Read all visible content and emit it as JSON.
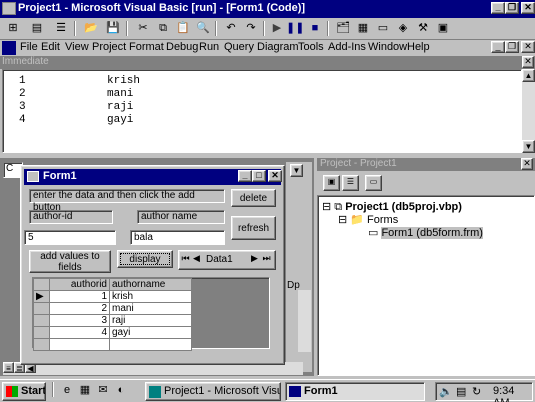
{
  "window": {
    "title": "Project1 - Microsoft Visual Basic [run] - [Form1 (Code)]"
  },
  "menu": [
    "File",
    "Edit",
    "View",
    "Project",
    "Format",
    "Debug",
    "Run",
    "Query",
    "Diagram",
    "Tools",
    "Add-Ins",
    "Window",
    "Help"
  ],
  "immediate": {
    "title": "Immediate",
    "rows": [
      {
        "num": "1",
        "name": "krish"
      },
      {
        "num": "2",
        "name": "mani"
      },
      {
        "num": "3",
        "name": "raji"
      },
      {
        "num": "4",
        "name": "gayi"
      }
    ]
  },
  "code": {
    "combo_text": "C",
    "fragment": "Dp"
  },
  "project": {
    "title": "Project - Project1",
    "root": "Project1 (db5proj.vbp)",
    "folder": "Forms",
    "file": "Form1 (db5form.frm)"
  },
  "form1": {
    "title": "Form1",
    "instructions": "enter the data and then click the add button",
    "author_id_label": "author-id",
    "author_name_label": "author name",
    "author_id_value": "5",
    "author_name_value": "bala",
    "delete_button": "delete",
    "refresh_button": "refresh",
    "add_button": "add values to fields",
    "display_button": "display",
    "data_control": "Data1",
    "grid": {
      "headers": [
        "authorid",
        "authorname"
      ],
      "rows": [
        {
          "id": "1",
          "name": "krish"
        },
        {
          "id": "2",
          "name": "mani"
        },
        {
          "id": "3",
          "name": "raji"
        },
        {
          "id": "4",
          "name": "gayi"
        }
      ]
    }
  },
  "taskbar": {
    "start": "Start",
    "tasks": [
      "Project1 - Microsoft Visual ...",
      "Form1"
    ],
    "clock": "9:34 AM"
  },
  "colors": {
    "title_active": "#000080",
    "face": "#c0c0c0",
    "inactive_title": "#808080"
  }
}
